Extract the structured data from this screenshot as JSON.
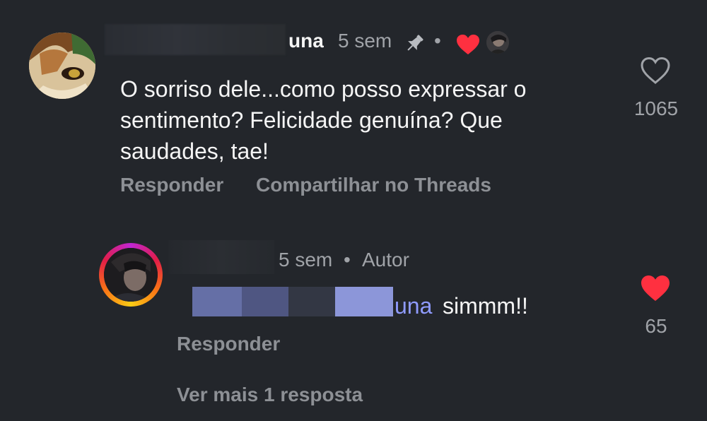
{
  "comment": {
    "username_suffix": "una",
    "time": "5 sem",
    "dot": "•",
    "text": "O sorriso dele...como posso expressar o sentimento? Felicidade genuína? Que saudades, tae!",
    "reply_label": "Responder",
    "share_label": "Compartilhar no Threads",
    "like_count": "1065"
  },
  "reply": {
    "time": "5 sem",
    "dot": "•",
    "author_label": "Autor",
    "mention_suffix": "una",
    "text": "simmm!!",
    "reply_label": "Responder",
    "like_count": "65"
  },
  "more_replies_label": "Ver mais 1 resposta",
  "colors": {
    "background": "#23262b",
    "like_red": "#ff3040",
    "mention_blue": "#8f9bff",
    "muted_text": "#8d9095"
  },
  "icons": {
    "pin": "pin-icon",
    "creator_liked": "heart-icon",
    "like_outline": "heart-outline-icon",
    "like_filled": "heart-filled-icon"
  }
}
